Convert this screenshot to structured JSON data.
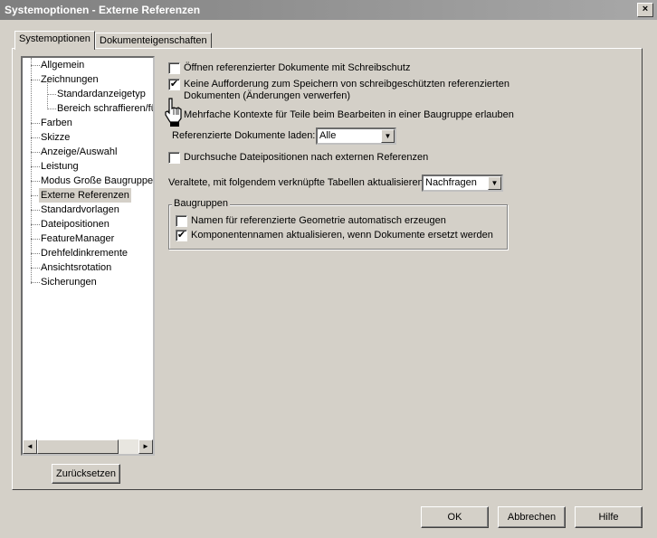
{
  "window": {
    "title": "Systemoptionen - Externe Referenzen",
    "close_label": "×"
  },
  "tabs": [
    {
      "label": "Systemoptionen"
    },
    {
      "label": "Dokumenteigenschaften"
    }
  ],
  "tree": {
    "items": [
      {
        "label": "Allgemein"
      },
      {
        "label": "Zeichnungen"
      },
      {
        "label": "Standardanzeigetyp"
      },
      {
        "label": "Bereich schraffieren/fü"
      },
      {
        "label": "Farben"
      },
      {
        "label": "Skizze"
      },
      {
        "label": "Anzeige/Auswahl"
      },
      {
        "label": "Leistung"
      },
      {
        "label": "Modus Große Baugruppe"
      },
      {
        "label": "Externe Referenzen"
      },
      {
        "label": "Standardvorlagen"
      },
      {
        "label": "Dateipositionen"
      },
      {
        "label": "FeatureManager"
      },
      {
        "label": "Drehfeldinkremente"
      },
      {
        "label": "Ansichtsrotation"
      },
      {
        "label": "Sicherungen"
      }
    ],
    "selected": "Externe Referenzen",
    "scroll_left": "◄",
    "scroll_right": "►"
  },
  "reset_button": "Zurücksetzen",
  "options": {
    "open_readonly": {
      "label": "Öffnen referenzierter Dokumente mit Schreibschutz",
      "checked": false
    },
    "no_save_prompt": {
      "label_line1": "Keine Aufforderung zum Speichern von schreibgeschützten referenzierten",
      "label_line2": "Dokumenten (Änderungen verwerfen)",
      "checked": true
    },
    "multi_context": {
      "label": "Mehrfache Kontexte für Teile beim Bearbeiten in einer Baugruppe erlauben",
      "checked": false
    },
    "load_refs": {
      "label": "Referenzierte Dokumente laden:",
      "value": "Alle"
    },
    "search_files": {
      "label": "Durchsuche Dateipositionen nach externen Referenzen",
      "checked": false
    },
    "update_tables": {
      "label": "Veraltete, mit folgendem verknüpfte Tabellen aktualisieren:",
      "value": "Nachfragen"
    }
  },
  "assemblies": {
    "title": "Baugruppen",
    "auto_names": {
      "label": "Namen für referenzierte Geometrie automatisch erzeugen",
      "checked": false
    },
    "update_names": {
      "label": "Komponentennamen aktualisieren, wenn Dokumente ersetzt werden",
      "checked": true
    }
  },
  "footer": {
    "ok": "OK",
    "cancel": "Abbrechen",
    "help": "Hilfe"
  },
  "check_glyph": "✔",
  "dropdown_glyph": "▼",
  "colors": {
    "dialog_bg": "#d4d0c8",
    "titlebar": "#8a8a8a"
  }
}
